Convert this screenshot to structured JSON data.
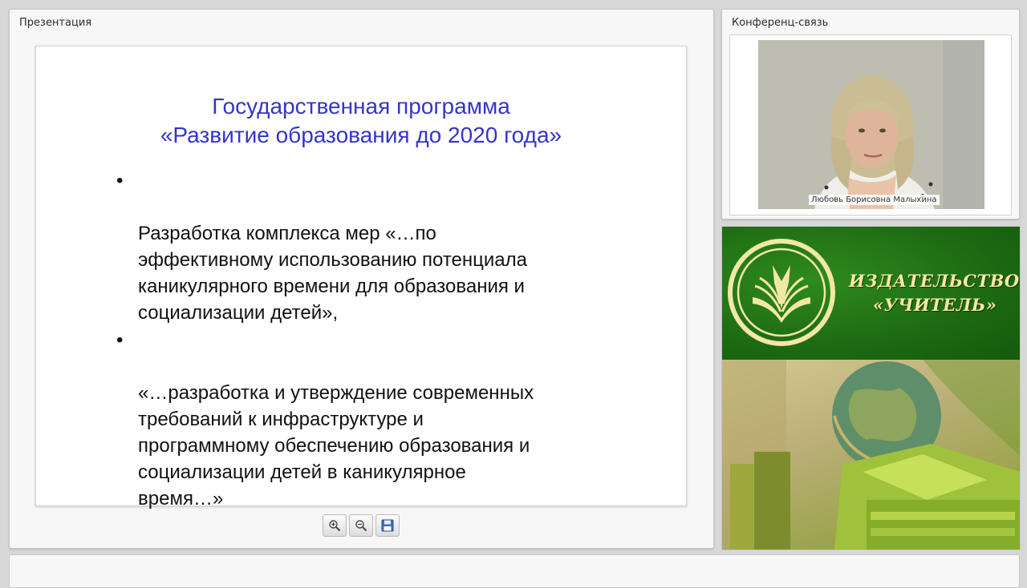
{
  "presentation_panel": {
    "title": "Презентация"
  },
  "slide": {
    "title_line1": "Государственная программа",
    "title_line2": "«Развитие образования до 2020 года»",
    "bullet_marker": "•",
    "bullets": [
      "Разработка  комплекса мер «…по\nэффективному использованию потенциала\nканикулярного времени для образования и\nсоциализации детей»,",
      "«…разработка и утверждение современных\nтребований к инфраструктуре и\nпрограммному обеспечению образования и\nсоциализации детей в каникулярное\nвремя…»"
    ]
  },
  "toolbar": {
    "zoom_in_icon": "zoom-in-icon",
    "zoom_out_icon": "zoom-out-icon",
    "save_icon": "floppy-disk-icon"
  },
  "conference_panel": {
    "title": "Конференц-связь",
    "speaker_name": "Любовь Борисовна Малыхина"
  },
  "publisher_banner": {
    "line1": "ИЗДАТЕЛЬСТВО",
    "line2": "«УЧИТЕЛЬ»",
    "colors": {
      "green": "#1d6a12",
      "gold_text": "#f7e9a2"
    }
  },
  "colors": {
    "slide_title": "#3535c8",
    "slide_text": "#111111",
    "panel_bg": "#f7f7f7",
    "page_bg": "#d7d7d7"
  }
}
